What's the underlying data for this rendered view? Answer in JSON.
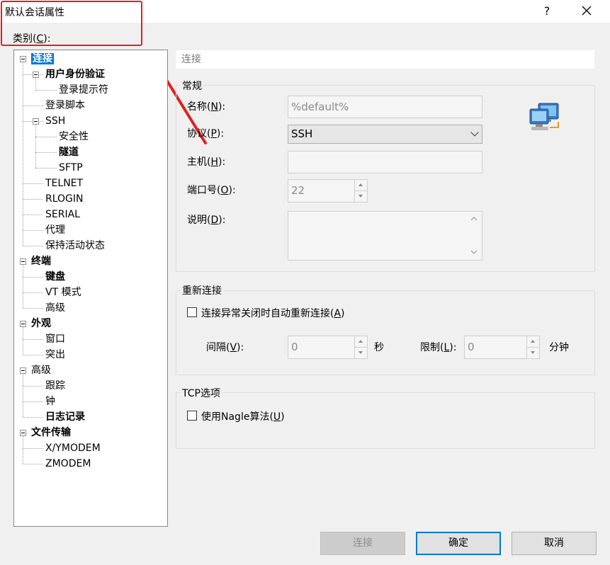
{
  "window": {
    "title": "默认会话属性",
    "help_label": "?",
    "category_label_pre": "类别(",
    "category_label_key": "C",
    "category_label_post": "):"
  },
  "tree": [
    {
      "label": "连接",
      "level": 0,
      "bold": true,
      "selected": true,
      "toggle": true
    },
    {
      "label": "用户身份验证",
      "level": 1,
      "bold": true,
      "toggle": true
    },
    {
      "label": "登录提示符",
      "level": 2
    },
    {
      "label": "登录脚本",
      "level": 1
    },
    {
      "label": "SSH",
      "level": 1,
      "toggle": true
    },
    {
      "label": "安全性",
      "level": 2
    },
    {
      "label": "隧道",
      "level": 2,
      "bold": true
    },
    {
      "label": "SFTP",
      "level": 2
    },
    {
      "label": "TELNET",
      "level": 1
    },
    {
      "label": "RLOGIN",
      "level": 1
    },
    {
      "label": "SERIAL",
      "level": 1
    },
    {
      "label": "代理",
      "level": 1
    },
    {
      "label": "保持活动状态",
      "level": 1
    },
    {
      "label": "终端",
      "level": 0,
      "bold": true,
      "toggle": true
    },
    {
      "label": "键盘",
      "level": 1,
      "bold": true
    },
    {
      "label": "VT 模式",
      "level": 1
    },
    {
      "label": "高级",
      "level": 1
    },
    {
      "label": "外观",
      "level": 0,
      "bold": true,
      "toggle": true
    },
    {
      "label": "窗口",
      "level": 1
    },
    {
      "label": "突出",
      "level": 1
    },
    {
      "label": "高级",
      "level": 0,
      "toggle": true
    },
    {
      "label": "跟踪",
      "level": 1
    },
    {
      "label": "钟",
      "level": 1
    },
    {
      "label": "日志记录",
      "level": 1,
      "bold": true
    },
    {
      "label": "文件传输",
      "level": 0,
      "bold": true,
      "toggle": true
    },
    {
      "label": "X/YMODEM",
      "level": 1
    },
    {
      "label": "ZMODEM",
      "level": 1
    }
  ],
  "panel": {
    "header": "连接",
    "general": {
      "title": "常规",
      "name_label": "名称(",
      "name_key": "N",
      "name_value": "%default%",
      "protocol_label": "协议(",
      "protocol_key": "P",
      "protocol_value": "SSH",
      "host_label": "主机(",
      "host_key": "H",
      "host_value": "",
      "port_label": "端口号(",
      "port_key": "O",
      "port_value": "22",
      "desc_label": "说明(",
      "desc_key": "D",
      "desc_value": "",
      "label_close": "):"
    },
    "reconnect": {
      "title": "重新连接",
      "checkbox_label": "连接异常关闭时自动重新连接(",
      "checkbox_key": "A",
      "checkbox_close": ")",
      "interval_label": "间隔(",
      "interval_key": "V",
      "interval_value": "0",
      "interval_unit": "秒",
      "limit_label": "限制(",
      "limit_key": "L",
      "limit_value": "0",
      "limit_unit": "分钟",
      "label_close": "):"
    },
    "tcp": {
      "title": "TCP选项",
      "checkbox_label": "使用Nagle算法(",
      "checkbox_key": "U",
      "checkbox_close": ")"
    }
  },
  "buttons": {
    "connect": "连接",
    "ok": "确定",
    "cancel": "取消"
  },
  "colors": {
    "selection": "#0078d7",
    "annotation": "#e02020"
  }
}
